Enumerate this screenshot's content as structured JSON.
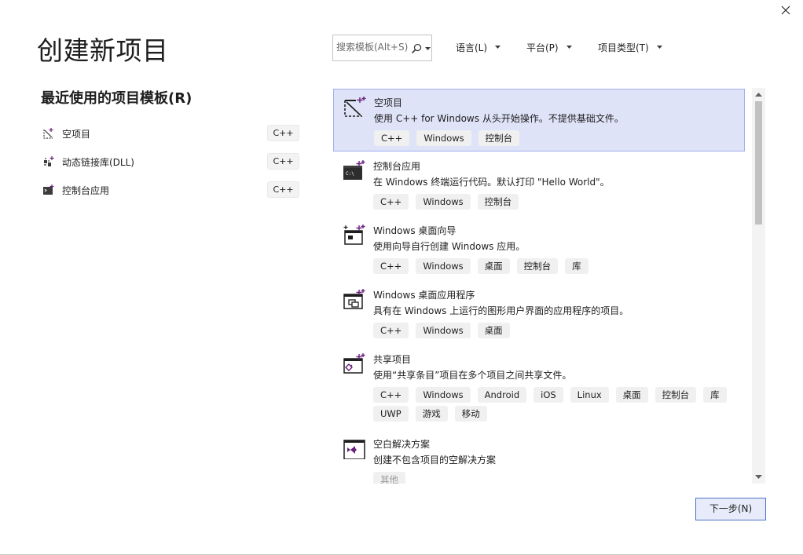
{
  "window": {
    "title": "创建新项目",
    "close_icon": "close-icon"
  },
  "recent": {
    "title": "最近使用的项目模板(R)",
    "items": [
      {
        "label": "空项目",
        "lang": "C++",
        "icon": "empty-project-icon"
      },
      {
        "label": "动态链接库(DLL)",
        "lang": "C++",
        "icon": "dll-icon"
      },
      {
        "label": "控制台应用",
        "lang": "C++",
        "icon": "console-app-icon"
      }
    ]
  },
  "search": {
    "placeholder": "搜索模板(Alt+S)",
    "icon": "search-icon"
  },
  "filters": {
    "language": "语言(L)",
    "platform": "平台(P)",
    "project_type": "项目类型(T)"
  },
  "templates": [
    {
      "name": "空项目",
      "desc": "使用 C++ for Windows 从头开始操作。不提供基础文件。",
      "tags": [
        "C++",
        "Windows",
        "控制台"
      ],
      "icon": "empty-project-icon",
      "selected": true
    },
    {
      "name": "控制台应用",
      "desc": "在 Windows 终端运行代码。默认打印 \"Hello World\"。",
      "tags": [
        "C++",
        "Windows",
        "控制台"
      ],
      "icon": "console-app-icon"
    },
    {
      "name": "Windows 桌面向导",
      "desc": "使用向导自行创建 Windows 应用。",
      "tags": [
        "C++",
        "Windows",
        "桌面",
        "控制台",
        "库"
      ],
      "icon": "desktop-wizard-icon"
    },
    {
      "name": "Windows 桌面应用程序",
      "desc": "具有在 Windows 上运行的图形用户界面的应用程序的项目。",
      "tags": [
        "C++",
        "Windows",
        "桌面"
      ],
      "icon": "desktop-app-icon"
    },
    {
      "name": "共享项目",
      "desc": "使用“共享条目”项目在多个项目之间共享文件。",
      "tags": [
        "C++",
        "Windows",
        "Android",
        "iOS",
        "Linux",
        "桌面",
        "控制台",
        "库",
        "UWP",
        "游戏",
        "移动"
      ],
      "icon": "shared-project-icon"
    },
    {
      "name": "空白解决方案",
      "desc": "创建不包含项目的空解决方案",
      "tags": [
        "其他"
      ],
      "icon": "visual-studio-icon"
    }
  ],
  "actions": {
    "next": "下一步(N)"
  },
  "colors": {
    "selection_bg": "#dfe3f8",
    "selection_border": "#a0aef0",
    "accent_purple": "#68217a",
    "button_border": "#4b73c8"
  }
}
